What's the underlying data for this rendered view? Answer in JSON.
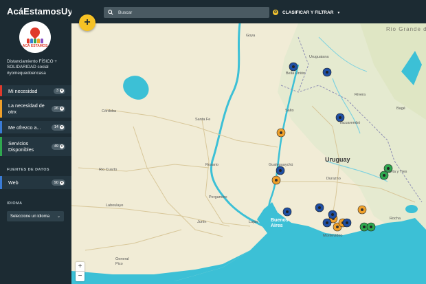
{
  "app": {
    "title": "AcáEstamosUy"
  },
  "logo": {
    "text": "ACÁ ESTAMOS"
  },
  "sidebar": {
    "tagline": "Distanciamiento FÍSICO + SOLIDARIDAD social #yomequedoencasa",
    "items": [
      {
        "label": "Mi necesidad",
        "count": "3",
        "accent": "#e03a2c"
      },
      {
        "label": "La necesidad de otrx",
        "count": "26",
        "accent": "#f0a02a"
      },
      {
        "label": "Me ofrezco a...",
        "count": "14",
        "accent": "#3a7bd5"
      },
      {
        "label": "Servicios Disponibles",
        "count": "49",
        "accent": "#2fa84f"
      }
    ],
    "sources_title": "FUENTES DE DATOS",
    "sources": [
      {
        "label": "Web",
        "count": "90"
      }
    ],
    "language_title": "IDIOMA",
    "language_select": "Seleccione un idioma"
  },
  "toolbar": {
    "search_placeholder": "Buscar",
    "filter_label": "CLASIFICAR Y FILTRAR"
  },
  "map": {
    "zoom_in": "+",
    "zoom_out": "−",
    "add_label": "+",
    "labels": {
      "rio_grande": "Rio Grande do Sul",
      "goya": "Goya",
      "uruguaiana": "Uruguaiana",
      "bella_union": "Bella Unión",
      "cordoba": "Córdoba",
      "santa_fe": "Santa Fe",
      "salto": "Salto",
      "tacuarembo": "Tacuarembó",
      "rivera": "Rivera",
      "bage": "Bagé",
      "rio_cuarto": "Rio Cuarto",
      "rosario": "Rosario",
      "gualeguaychu": "Gualeguaychú",
      "uruguay": "Uruguay",
      "treinta_tres": "Treinta y Tres",
      "durazno": "Durazno",
      "pergamino": "Pergamino",
      "laboulaye": "Laboulaye",
      "junin": "Junín",
      "lujan": "Luján",
      "buenos_aires": "Buenos Aires",
      "montevideo": "Montevideo",
      "rocha": "Rocha",
      "general_pico": "General Pico"
    }
  },
  "colors": {
    "need_red": "#e03a2c",
    "other_orange": "#f0a02a",
    "offer_blue": "#1f4fa3",
    "service_green": "#2fa84f",
    "accent_yellow": "#f6c225",
    "water": "#3cc0d6",
    "land": "#f1ecd6"
  }
}
